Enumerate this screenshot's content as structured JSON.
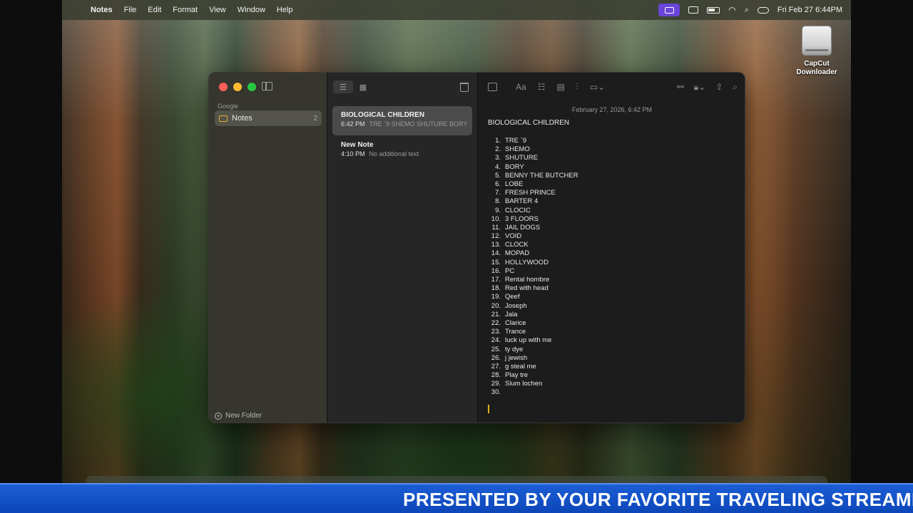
{
  "menubar": {
    "app_name": "Notes",
    "items": [
      "File",
      "Edit",
      "Format",
      "View",
      "Window",
      "Help"
    ],
    "clock": "Fri Feb 27  6:44PM"
  },
  "desktop": {
    "icon_label_1": "CapCut",
    "icon_label_2": "Downloader"
  },
  "sidebar": {
    "account": "Google",
    "folder": {
      "name": "Notes",
      "count": "2"
    },
    "new_folder": "New Folder"
  },
  "note_list": [
    {
      "title": "BIOLOGICAL CHILDREN",
      "time": "6:42 PM",
      "preview": "TRE `9 SHEMO SHUTURE BORY"
    },
    {
      "title": "New Note",
      "time": "4:10 PM",
      "preview": "No additional text"
    }
  ],
  "editor": {
    "date": "February 27, 2026, 6:42 PM",
    "title": "BIOLOGICAL CHILDREN",
    "items": [
      "TRE `9",
      "SHEMO",
      "SHUTURE",
      "BORY",
      "BENNY THE BUTCHER",
      "LOBE",
      "FRESH PRINCE",
      "BARTER 4",
      "CLOCIC",
      "3 FLOORS",
      "JAIL DOGS",
      "VOID",
      "CLOCK",
      "MOPAD",
      "HOLLYWOOD",
      "PC",
      "Rental hombre",
      "Red with head",
      "Qeef",
      "Joseph",
      "Jala",
      "Clarice",
      "Trance",
      "luck up with me",
      "ty dye",
      "j jewish",
      "g steal me",
      "Play tre",
      "Slum lochen",
      ""
    ]
  },
  "banner": {
    "text": "PRESENTED BY YOUR FAVORITE TRAVELING STREAME"
  },
  "colors": {
    "banner": "#1c5ed6",
    "accent_yellow": "#e0b020",
    "selected_note": "#4b4b4b"
  }
}
